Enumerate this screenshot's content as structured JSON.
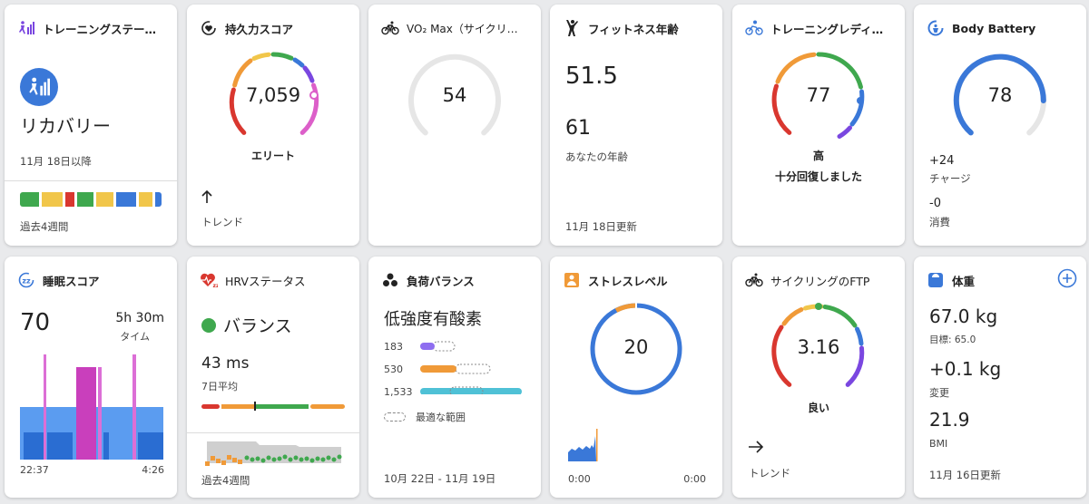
{
  "training_status": {
    "title": "トレーニングステー…",
    "status": "リカバリー",
    "since": "11月 18日以降",
    "footer": "過去4週間"
  },
  "endurance": {
    "title": "持久力スコア",
    "value": "7,059",
    "label": "エリート",
    "trend_label": "トレンド"
  },
  "vo2": {
    "title": "VO₂ Max（サイクリ…",
    "value": "54"
  },
  "fitness_age": {
    "title": "フィットネス年齢",
    "value": "51.5",
    "actual": "61",
    "actual_label": "あなたの年齢",
    "updated": "11月 18日更新"
  },
  "readiness": {
    "title": "トレーニングレディ…",
    "value": "77",
    "level": "高",
    "message": "十分回復しました"
  },
  "body_battery": {
    "title": "Body Battery",
    "value": "78",
    "charge": "+24",
    "charge_label": "チャージ",
    "drain": "-0",
    "drain_label": "消費"
  },
  "sleep": {
    "title": "睡眠スコア",
    "score": "70",
    "duration": "5h 30m",
    "duration_label": "タイム",
    "start": "22:37",
    "end": "4:26"
  },
  "hrv": {
    "title": "HRVステータス",
    "status": "バランス",
    "value": "43 ms",
    "value_label": "7日平均",
    "footer": "過去4週間"
  },
  "load": {
    "title": "負荷バランス",
    "focus": "低強度有酸素",
    "rows": [
      {
        "value": "183"
      },
      {
        "value": "530"
      },
      {
        "value": "1,533"
      }
    ],
    "legend": "最適な範囲",
    "range": "10月 22日 - 11月 19日"
  },
  "stress": {
    "title": "ストレスレベル",
    "value": "20",
    "start": "0:00",
    "end": "0:00"
  },
  "ftp": {
    "title": "サイクリングのFTP",
    "value": "3.16",
    "label": "良い",
    "trend_label": "トレンド"
  },
  "weight": {
    "title": "体重",
    "weight": "67.0 kg",
    "goal": "目標: 65.0",
    "change": "+0.1 kg",
    "change_label": "変更",
    "bmi": "21.9",
    "bmi_label": "BMI",
    "updated": "11月 16日更新"
  },
  "colors": {
    "blue": "#3a78d8",
    "red": "#d9372f",
    "orange": "#f09a38",
    "green": "#3fa84e",
    "purple": "#7a47e0",
    "pink": "#dc5fc9",
    "yellow": "#f1c64a",
    "gray": "#e6e6e6"
  }
}
